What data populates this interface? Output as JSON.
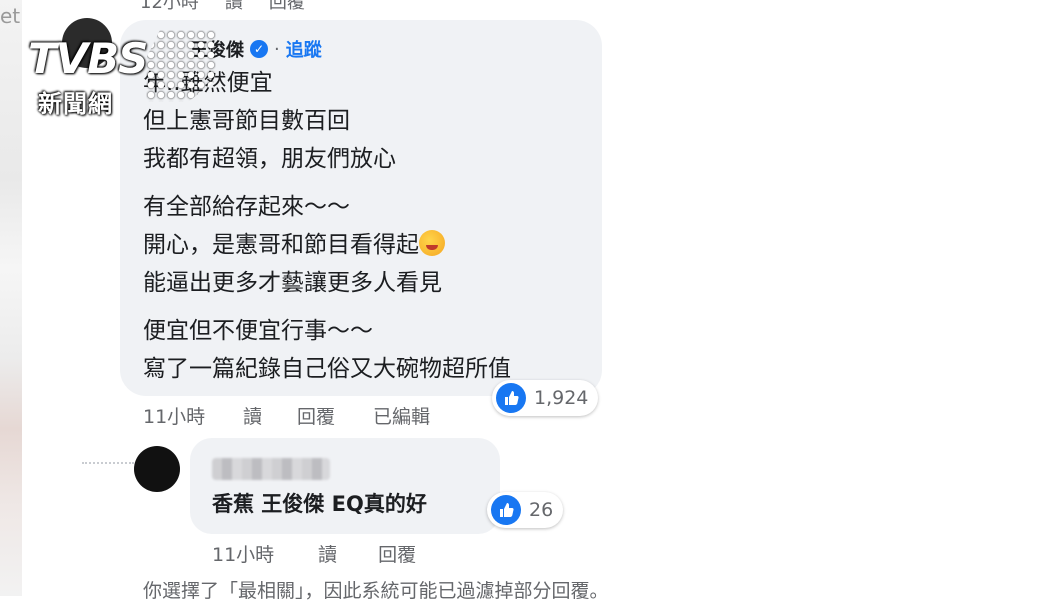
{
  "background": {
    "left_strip_text": "et"
  },
  "top_meta": {
    "time": "12小時",
    "read": "讀",
    "reply": "回覆"
  },
  "main_comment": {
    "author": "王俊傑",
    "separator": "·",
    "follow": "追蹤",
    "paragraphs": [
      [
        "年..雖然便宜",
        "但上憲哥節目數百回",
        "我都有超領，朋友們放心"
      ],
      [
        "有全部給存起來～～",
        "開心，是憲哥和節目看得起",
        "能逼出更多才藝讓更多人看見"
      ],
      [
        "便宜但不便宜行事～～",
        "寫了一篇紀錄自己俗又大碗物超所值"
      ]
    ],
    "emoji": "heart-face-emoji",
    "reaction_count": "1,924",
    "meta": {
      "time": "11小時",
      "read": "讀",
      "reply": "回覆",
      "edited": "已編輯"
    }
  },
  "reply_comment": {
    "text": "香蕉 王俊傑 EQ真的好",
    "reaction_count": "26",
    "meta": {
      "time": "11小時",
      "read": "讀",
      "reply": "回覆"
    }
  },
  "filter_note": "你選擇了「最相關」，因此系統可能已過濾掉部分回覆。",
  "watermark": {
    "logo": "TVBS",
    "subtitle": "新聞網"
  },
  "colors": {
    "accent": "#1877f2",
    "bubble": "#f0f2f5",
    "meta_text": "#65676b"
  }
}
